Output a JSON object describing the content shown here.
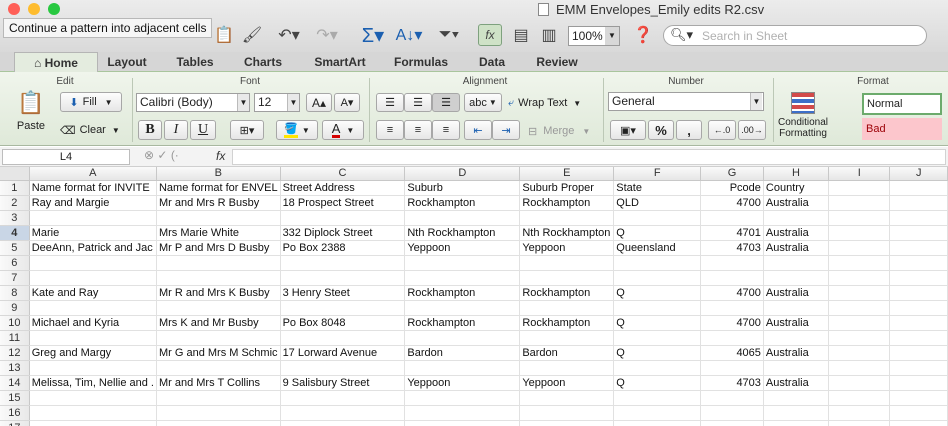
{
  "window": {
    "title": "EMM Envelopes_Emily edits R2.csv",
    "tooltip": "Continue a pattern into adjacent cells",
    "zoom": "100%",
    "search_placeholder": "Search in Sheet",
    "lights": [
      "#ff5f57",
      "#febc2e",
      "#28c840"
    ]
  },
  "tabs": [
    {
      "label": "Home",
      "active": true
    },
    {
      "label": "Layout"
    },
    {
      "label": "Tables"
    },
    {
      "label": "Charts"
    },
    {
      "label": "SmartArt"
    },
    {
      "label": "Formulas"
    },
    {
      "label": "Data"
    },
    {
      "label": "Review"
    }
  ],
  "ribbon": {
    "groups": {
      "edit": "Edit",
      "font": "Font",
      "alignment": "Alignment",
      "number": "Number",
      "format": "Format"
    },
    "paste": "Paste",
    "fill": "Fill",
    "clear": "Clear",
    "font_name": "Calibri (Body)",
    "font_size": "12",
    "bold": "B",
    "italic": "I",
    "underline": "U",
    "wrap_text": "Wrap Text",
    "merge": "Merge",
    "text_direction": "abc",
    "number_format": "General",
    "percent": "%",
    "comma": ",",
    "conditional_formatting": "Conditional Formatting",
    "style_normal": "Normal",
    "style_bad": "Bad",
    "fill_color": "#ffe600",
    "font_color": "#d40000"
  },
  "formula_bar": {
    "cell": "L4",
    "fx": "fx",
    "value": ""
  },
  "sheet": {
    "columns": [
      "A",
      "B",
      "C",
      "D",
      "E",
      "F",
      "G",
      "H",
      "I",
      "J"
    ],
    "selected_row": 4,
    "rows": [
      {
        "n": "1",
        "cells": [
          "Name format for  INVITE",
          "Name format for ENVEL",
          "Street Address",
          "Suburb",
          "Suburb Proper",
          "State",
          "Pcode",
          "Country",
          "",
          ""
        ]
      },
      {
        "n": "2",
        "cells": [
          "Ray and Margie",
          "Mr and Mrs R Busby",
          "18 Prospect Street",
          "Rockhampton",
          "Rockhampton",
          "QLD",
          "4700",
          "Australia",
          "",
          ""
        ]
      },
      {
        "n": "3",
        "cells": [
          "",
          "",
          "",
          "",
          "",
          "",
          "",
          "",
          "",
          ""
        ]
      },
      {
        "n": "4",
        "cells": [
          "Marie",
          "Mrs Marie White",
          "332 Diplock Street",
          "Nth Rockhampton",
          "Nth Rockhampton",
          "Q",
          "4701",
          "Australia",
          "",
          ""
        ]
      },
      {
        "n": "5",
        "cells": [
          "DeeAnn, Patrick and Jac",
          "Mr P and Mrs D Busby",
          "Po Box 2388",
          "Yeppoon",
          "Yeppoon",
          "Queensland",
          "4703",
          "Australia",
          "",
          ""
        ]
      },
      {
        "n": "6",
        "cells": [
          "",
          "",
          "",
          "",
          "",
          "",
          "",
          "",
          "",
          ""
        ]
      },
      {
        "n": "7",
        "cells": [
          "",
          "",
          "",
          "",
          "",
          "",
          "",
          "",
          "",
          ""
        ]
      },
      {
        "n": "8",
        "cells": [
          "Kate and Ray",
          "Mr R and Mrs K Busby",
          "3 Henry Steet",
          "Rockhampton",
          "Rockhampton",
          "Q",
          "4700",
          "Australia",
          "",
          ""
        ]
      },
      {
        "n": "9",
        "cells": [
          "",
          "",
          "",
          "",
          "",
          "",
          "",
          "",
          "",
          ""
        ]
      },
      {
        "n": "10",
        "cells": [
          "Michael and Kyria",
          "Mrs K and Mr Busby",
          "Po Box 8048",
          "Rockhampton",
          "Rockhampton",
          "Q",
          "4700",
          "Australia",
          "",
          ""
        ]
      },
      {
        "n": "11",
        "cells": [
          "",
          "",
          "",
          "",
          "",
          "",
          "",
          "",
          "",
          ""
        ]
      },
      {
        "n": "12",
        "cells": [
          "Greg and Margy",
          "Mr G and Mrs M Schmic",
          "17 Lorward Avenue",
          "Bardon",
          "Bardon",
          "Q",
          "4065",
          "Australia",
          "",
          ""
        ]
      },
      {
        "n": "13",
        "cells": [
          "",
          "",
          "",
          "",
          "",
          "",
          "",
          "",
          "",
          ""
        ]
      },
      {
        "n": "14",
        "cells": [
          "Melissa, Tim, Nellie and .",
          "Mr and Mrs T Collins",
          "9 Salisbury Street",
          "Yeppoon",
          "Yeppoon",
          "Q",
          "4703",
          "Australia",
          "",
          ""
        ]
      },
      {
        "n": "15",
        "cells": [
          "",
          "",
          "",
          "",
          "",
          "",
          "",
          "",
          "",
          ""
        ]
      },
      {
        "n": "16",
        "cells": [
          "",
          "",
          "",
          "",
          "",
          "",
          "",
          "",
          "",
          ""
        ]
      },
      {
        "n": "17",
        "cells": [
          "",
          "",
          "",
          "",
          "",
          "",
          "",
          "",
          "",
          ""
        ]
      }
    ]
  }
}
